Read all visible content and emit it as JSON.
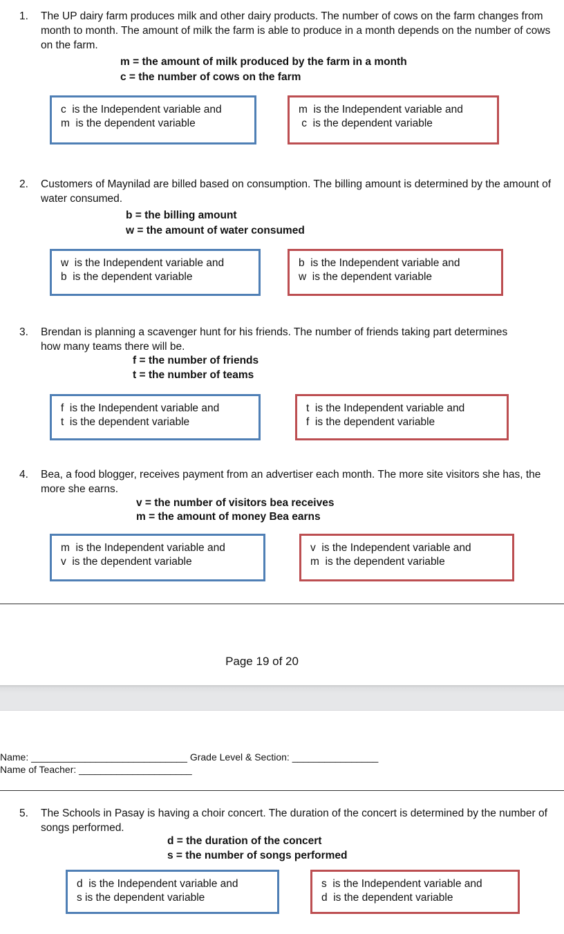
{
  "questions": [
    {
      "number": "1.",
      "text": "The UP dairy farm produces milk and other dairy products. The number of cows on the farm changes from month to month.  The amount of milk the farm is able to produce in a month depends on the number of cows on the farm.",
      "definitions": [
        "m = the amount of milk produced by the farm in a month",
        " c = the number of cows on the farm"
      ],
      "options": [
        {
          "color": "blue",
          "line1": "c  is the Independent variable and",
          "line2": "m  is the dependent variable"
        },
        {
          "color": "red",
          "line1": "m  is the Independent variable and",
          "line2": " c  is the dependent variable"
        }
      ]
    },
    {
      "number": "2.",
      "text": "Customers of Maynilad are billed based on consumption. The billing amount is determined by the amount of water consumed.",
      "definitions": [
        "b = the billing amount",
        "w = the amount of water consumed"
      ],
      "options": [
        {
          "color": "blue",
          "line1": "w  is the Independent variable and",
          "line2": "b  is the dependent variable"
        },
        {
          "color": "red",
          "line1": "b  is the Independent variable and",
          "line2": "w  is the dependent variable"
        }
      ]
    },
    {
      "number": "3.",
      "text": "Brendan is planning a scavenger hunt for his friends. The number of friends taking part determines how many teams there will be.",
      "definitions": [
        "f = the number of friends",
        "t = the number of teams"
      ],
      "options": [
        {
          "color": "blue",
          "line1": "f  is the Independent variable and",
          "line2": "t  is the dependent variable"
        },
        {
          "color": "red",
          "line1": "t  is the Independent variable and",
          "line2": "f  is the dependent variable"
        }
      ]
    },
    {
      "number": "4.",
      "text": "Bea, a food blogger, receives payment from an advertiser each month. The more site visitors she has, the more she earns.",
      "definitions": [
        "v =  the number of visitors bea receives",
        "m = the amount of money Bea earns"
      ],
      "options": [
        {
          "color": "blue",
          "line1": "m  is the Independent variable and",
          "line2": "v  is the dependent variable"
        },
        {
          "color": "red",
          "line1": "v  is the Independent variable and",
          "line2": "m  is the dependent variable"
        }
      ]
    },
    {
      "number": "5.",
      "text": "The Schools in Pasay is having a choir concert. The duration of the concert is determined by the number of songs performed.",
      "definitions": [
        "d = the duration of the concert",
        "s = the number of songs performed"
      ],
      "options": [
        {
          "color": "blue",
          "line1": "d  is the Independent variable and",
          "line2": "s is the dependent variable"
        },
        {
          "color": "red",
          "line1": "s  is the Independent variable and",
          "line2": "d  is the dependent variable"
        }
      ]
    }
  ],
  "footer": {
    "page_label": "Page 19 of 20"
  },
  "header_form": {
    "name_label": "Name: ",
    "name_blank": "_____________________________",
    "grade_label": " Grade Level & Section: ",
    "grade_blank": "________________",
    "teacher_label": "Name of Teacher: ",
    "teacher_blank": "_____________________"
  },
  "colors": {
    "blue_border": "#4f7fb5",
    "red_border": "#bc4e51"
  }
}
